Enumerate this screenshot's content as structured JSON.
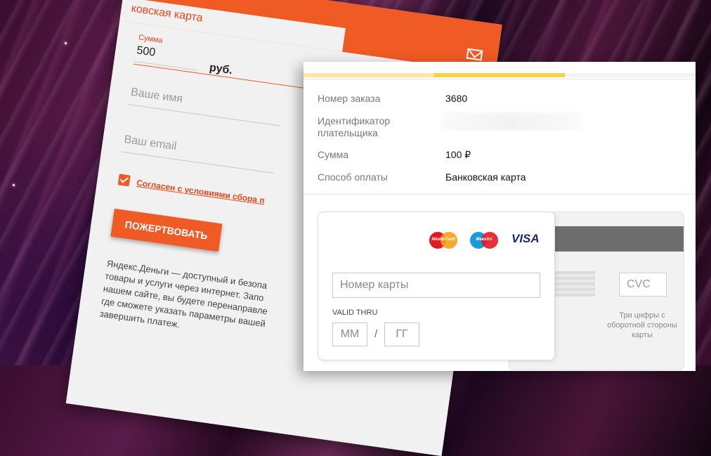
{
  "back_form": {
    "tab_title": "ковская карта",
    "amount_label": "Сумма",
    "amount_value": "500",
    "currency": "руб.",
    "name_placeholder": "Ваше имя",
    "email_placeholder": "Ваш email",
    "agree_text": "Согласен с условиями сбора п",
    "donate_button": "ПОЖЕРТВОВАТЬ",
    "description": "Яндекс.Деньги — доступный и безопа товары и услуги через интернет. Запо нашем сайте, вы будете перенаправле где сможете указать параметры вашей завершить платеж.",
    "accent_color": "#f05a24"
  },
  "order": {
    "rows": [
      {
        "label": "Номер заказа",
        "value": "3680"
      },
      {
        "label": "Идентификатор плательщика",
        "value": ""
      },
      {
        "label": "Сумма",
        "value": "100 ₽"
      },
      {
        "label": "Способ оплаты",
        "value": "Банковская карта"
      }
    ]
  },
  "card": {
    "brands": [
      "MasterCard",
      "Maestro",
      "VISA"
    ],
    "number_placeholder": "Номер карты",
    "valid_thru_label": "VALID THRU",
    "month_placeholder": "ММ",
    "year_placeholder": "ГГ",
    "date_separator": "/",
    "cvc_placeholder": "CVC",
    "cvc_help": "Три цифры с оборотной стороны карты"
  },
  "progress": {
    "steps_total": 3,
    "current_step": 2
  }
}
